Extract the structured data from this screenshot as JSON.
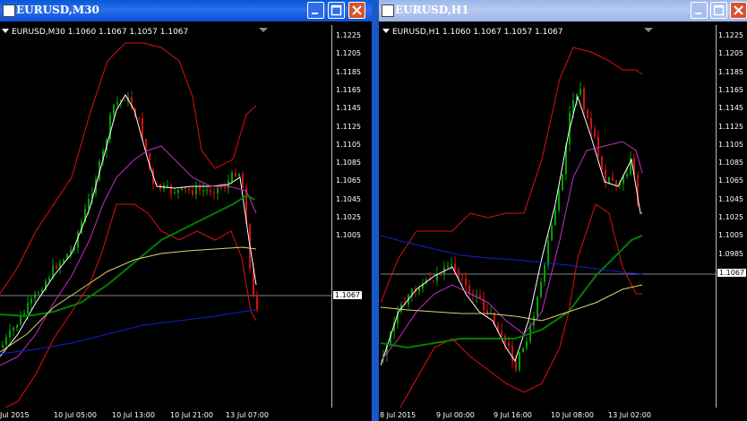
{
  "colors": {
    "bull": "#00a000",
    "bear": "#d01010",
    "bollinger": "#e01010",
    "ma_fast": "#ffffff",
    "ma_mid": "#c030c0",
    "ma_green": "#008000",
    "ma_yellow": "#e0d070",
    "ma_blue": "#1020d0"
  },
  "windows": [
    {
      "title": "EURUSD,M30",
      "header": "EURUSD,M30  1.1060 1.1067 1.1057 1.1067",
      "current_price": "1.1067",
      "y_ticks": [
        "1.1225",
        "1.1205",
        "1.1185",
        "1.1165",
        "1.1145",
        "1.1125",
        "1.1105",
        "1.1085",
        "1.1065",
        "1.1045",
        "1.1025",
        "1.1005"
      ],
      "x_ticks": [
        "Jul 2015",
        "10 Jul 05:00",
        "10 Jul 13:00",
        "10 Jul 21:00",
        "13 Jul 07:00"
      ],
      "controls": {
        "minimize": "minimize",
        "maximize": "maximize",
        "close": "close"
      }
    },
    {
      "title": "EURUSD,H1",
      "header": "EURUSD,H1  1.1060 1.1067 1.1057 1.1067",
      "current_price": "1.1067",
      "y_ticks": [
        "1.1225",
        "1.1205",
        "1.1185",
        "1.1165",
        "1.1145",
        "1.1125",
        "1.1105",
        "1.1085",
        "1.1065",
        "1.1045",
        "1.1025",
        "1.1005",
        "1.0985"
      ],
      "x_ticks": [
        "8 Jul 2015",
        "9 Jul 00:00",
        "9 Jul 16:00",
        "10 Jul 08:00",
        "13 Jul 02:00"
      ],
      "controls": {
        "minimize": "minimize",
        "maximize": "maximize",
        "close": "close"
      }
    }
  ]
}
